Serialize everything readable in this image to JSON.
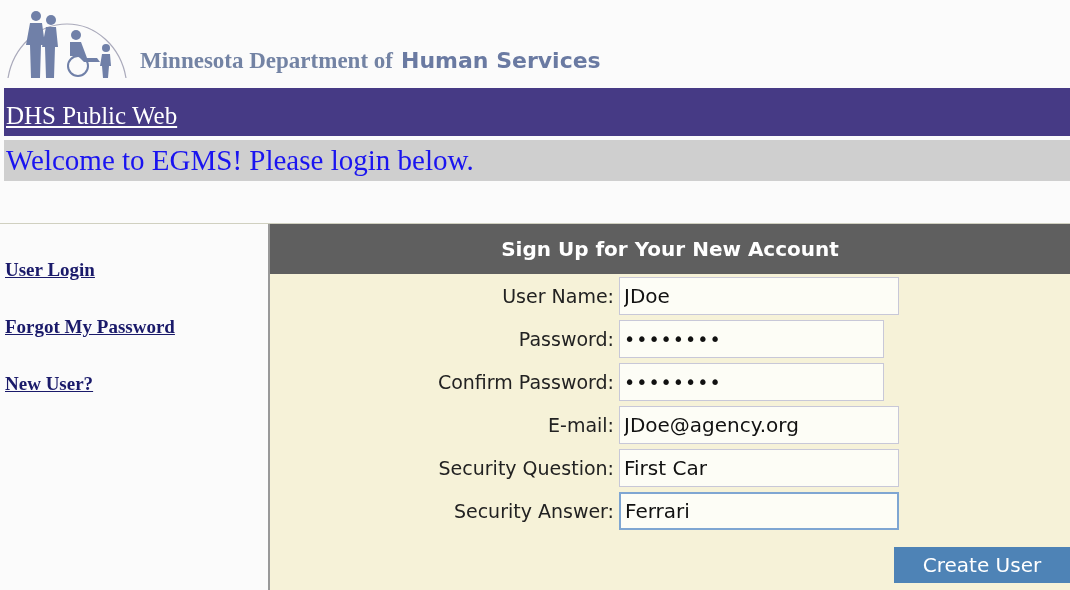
{
  "header": {
    "agency_prefix": "Minnesota Department of",
    "agency_name": "Human Services"
  },
  "nav_bar": {
    "link": "DHS Public Web"
  },
  "welcome": "Welcome to EGMS! Please login below.",
  "sidebar": {
    "links": [
      "User Login",
      "Forgot My Password",
      "New User?"
    ]
  },
  "form": {
    "title": "Sign Up for Your New Account",
    "fields": [
      {
        "label": "User Name:",
        "value": "JDoe",
        "kind": "text",
        "focused": false
      },
      {
        "label": "Password:",
        "value": "••••••••",
        "kind": "password",
        "focused": false
      },
      {
        "label": "Confirm Password:",
        "value": "••••••••",
        "kind": "password",
        "focused": false
      },
      {
        "label": "E-mail:",
        "value": "JDoe@agency.org",
        "kind": "text",
        "focused": false
      },
      {
        "label": "Security Question:",
        "value": "First Car",
        "kind": "text",
        "focused": false
      },
      {
        "label": "Security Answer:",
        "value": "Ferrari",
        "kind": "text",
        "focused": true
      }
    ],
    "submit": "Create User"
  }
}
